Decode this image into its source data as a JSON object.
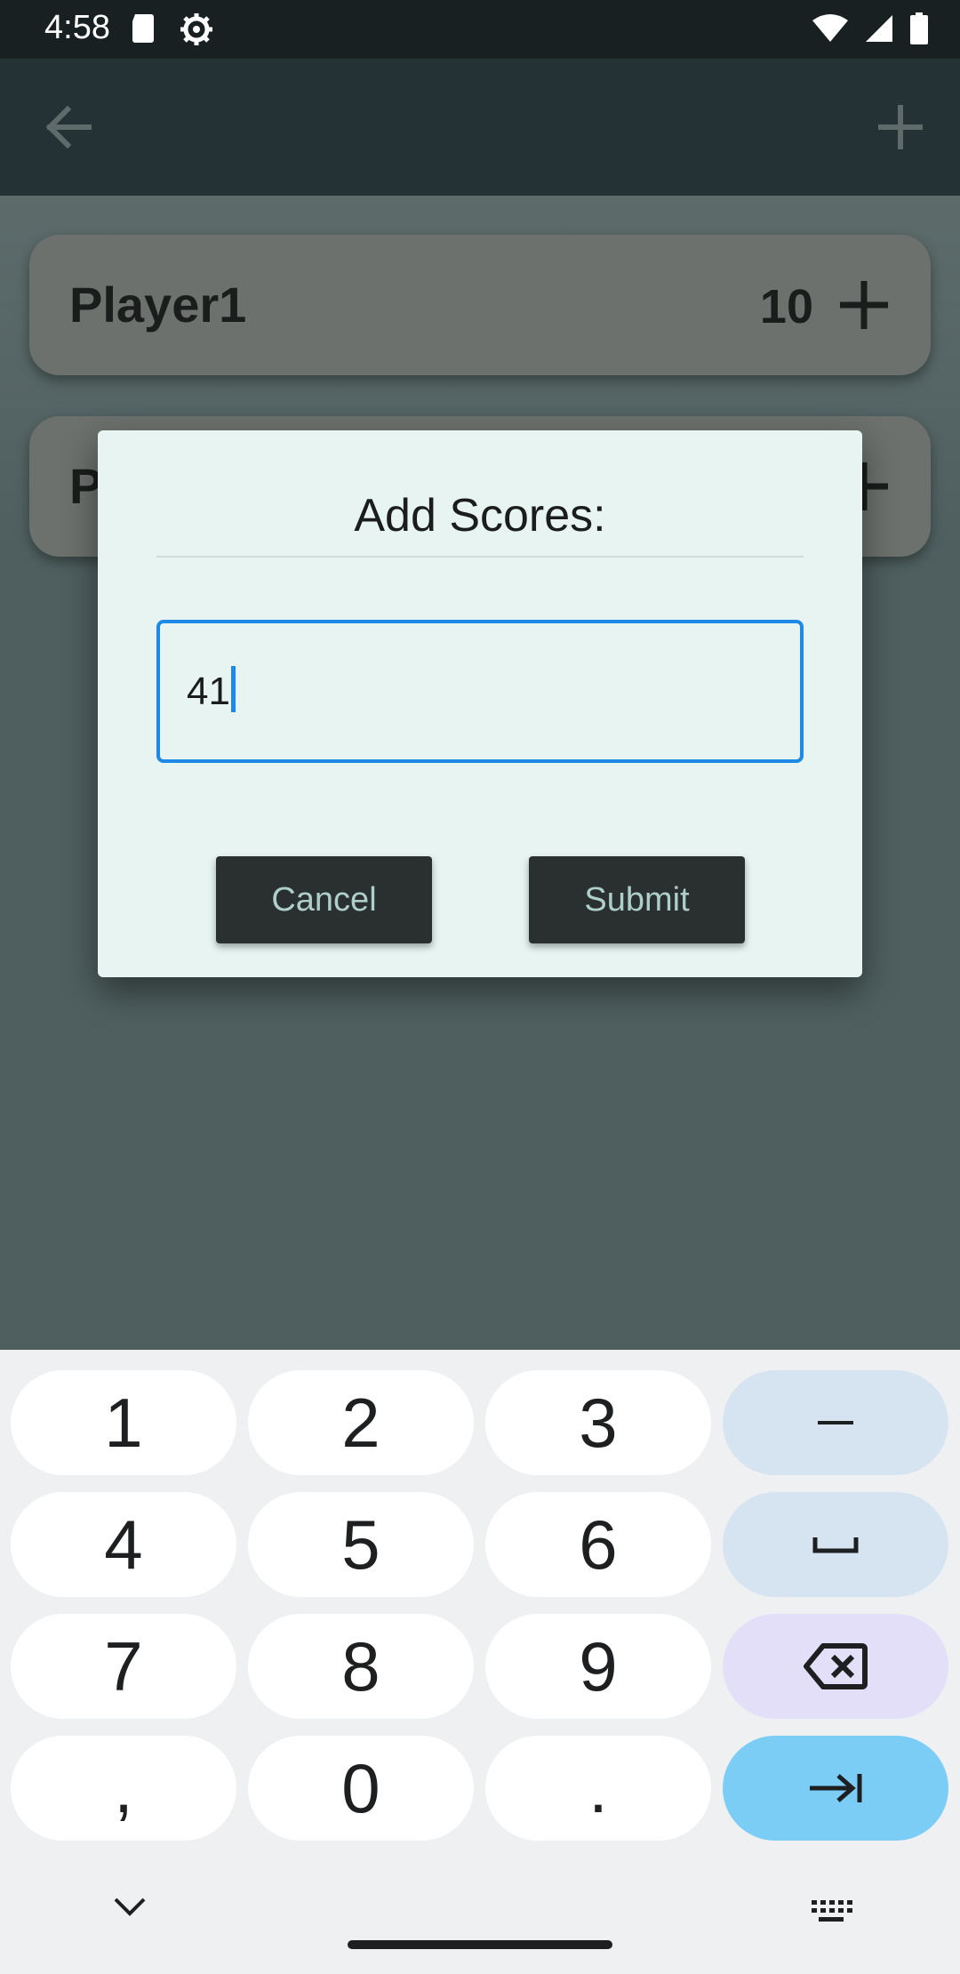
{
  "status_bar": {
    "time": "4:58",
    "icons": [
      "sd-card-icon",
      "settings-gear-icon",
      "wifi-icon",
      "signal-icon",
      "battery-icon"
    ]
  },
  "app_bar": {
    "back_icon": "arrow-back-icon",
    "add_icon": "plus-icon"
  },
  "players": [
    {
      "name": "Player1",
      "score": "10"
    },
    {
      "name": "P",
      "score": ""
    }
  ],
  "dialog": {
    "title": "Add Scores:",
    "input_value": "41",
    "cancel_label": "Cancel",
    "submit_label": "Submit"
  },
  "keyboard": {
    "rows": [
      [
        "1",
        "2",
        "3",
        "–"
      ],
      [
        "4",
        "5",
        "6",
        "␣"
      ],
      [
        "7",
        "8",
        "9",
        "⌫"
      ],
      [
        ",",
        "0",
        ".",
        "⇥"
      ]
    ]
  },
  "colors": {
    "accent": "#1e8ae5",
    "dialog_bg": "#e7f4f1",
    "button_bg": "#2a3030",
    "button_text": "#aececa",
    "enter_key": "#7ccdf6"
  }
}
